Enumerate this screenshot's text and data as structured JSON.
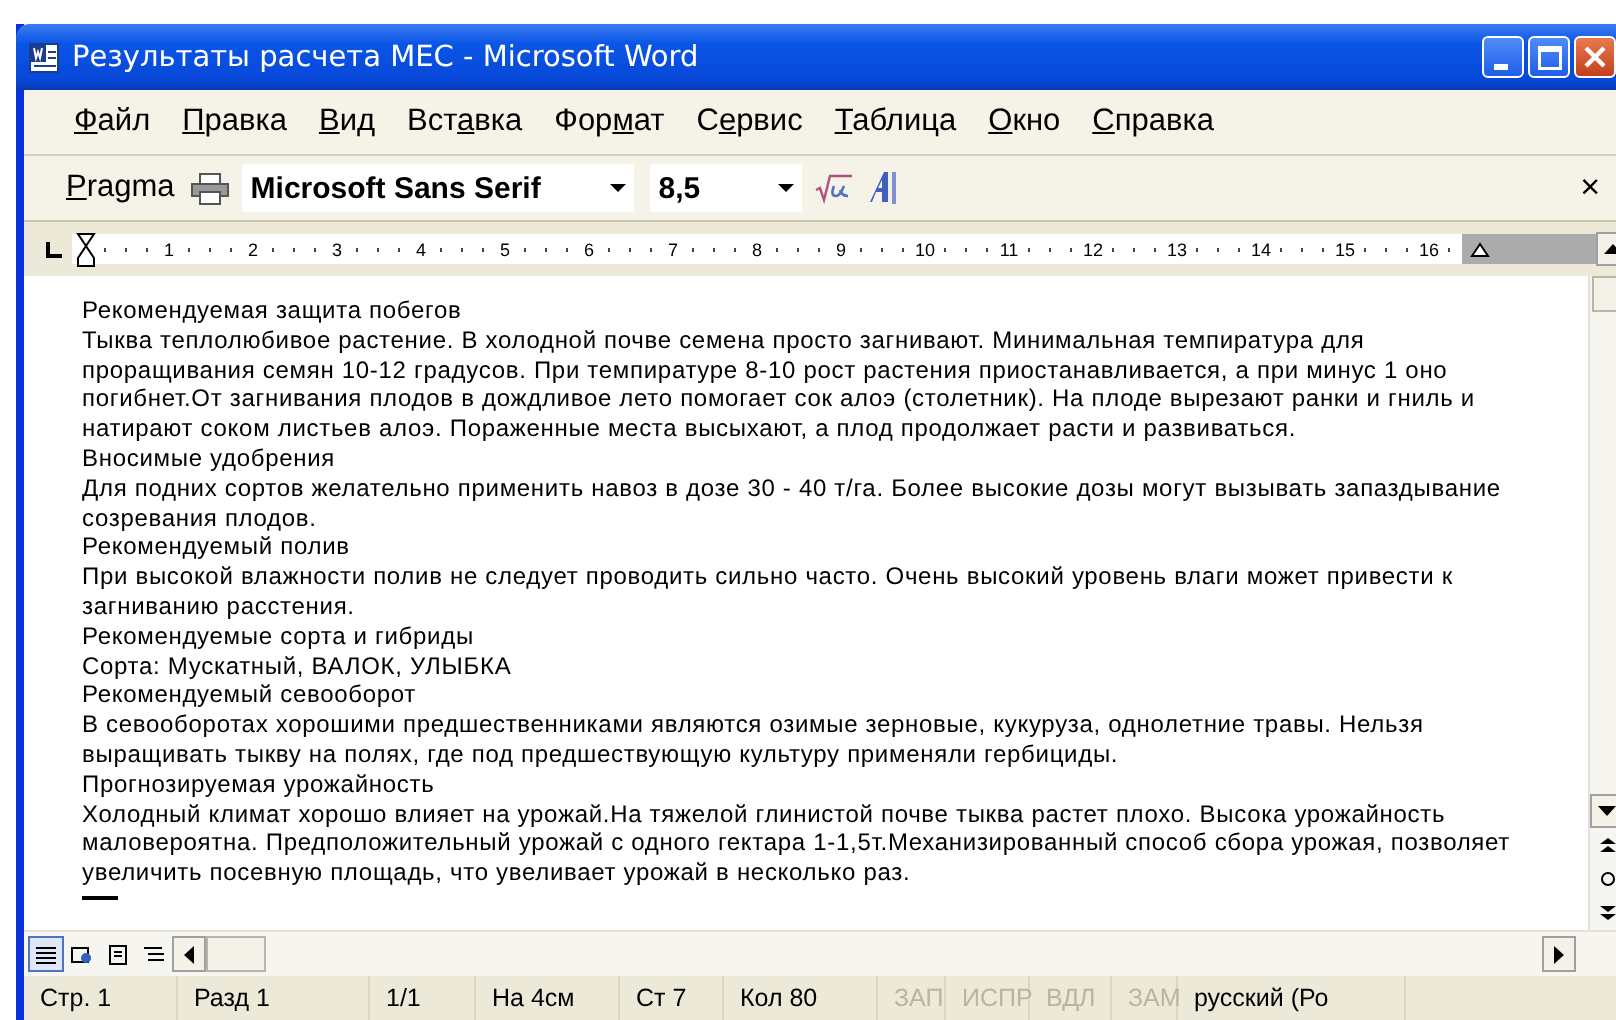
{
  "window": {
    "title": "Результаты расчета МЕС - Microsoft Word"
  },
  "menu": [
    {
      "key": "Ф",
      "after": "айл"
    },
    {
      "key": "П",
      "after": "равка"
    },
    {
      "key": "В",
      "after": "ид"
    },
    {
      "before": "Вст",
      "key": "а",
      "after": "вка"
    },
    {
      "before": "Фор",
      "key": "м",
      "after": "ат"
    },
    {
      "before": "С",
      "key": "е",
      "after": "рвис"
    },
    {
      "key": "Т",
      "after": "аблица"
    },
    {
      "key": "О",
      "after": "кно"
    },
    {
      "key": "С",
      "after": "правка"
    }
  ],
  "toolbar": {
    "style": {
      "key": "P",
      "after": "ragma"
    },
    "font": "Microsoft Sans Serif",
    "size": "8,5",
    "close": "×"
  },
  "ruler": {
    "numbers": [
      "1",
      "2",
      "3",
      "4",
      "5",
      "6",
      "7",
      "8",
      "9",
      "10",
      "11",
      "12",
      "13",
      "14",
      "15",
      "16"
    ]
  },
  "document": {
    "paragraphs": [
      "Рекомендуемая защита побегов",
      "Тыква теплолюбивое растение. В холодной почве семена просто загнивают. Минимальная темпиратура для проращивания семян 10-12 градусов. При темпиратуре 8-10 рост растения приостанавливается, а при минус 1 оно погибнет.От загнивания плодов в дождливое лето помогает сок алоэ (столетник). На плоде вырезают ранки и гниль и натирают соком листьев алоэ. Пораженные места высыхают, а плод продолжает расти и развиваться.",
      "Вносимые удобрения",
      "Для подних сортов желательно применить навоз  в дозе 30 - 40 т/га. Более высокие дозы могут вызывать запаздывание созревания плодов.",
      "Рекомендуемый полив",
      "При высокой влажности полив не следует проводить сильно часто. Очень высокий уровень влаги может привести к загниванию расстения.",
      "Рекомендуемые сорта и гибриды",
      "Сорта: Мускатный, ВАЛОК, УЛЫБКА",
      "Рекомендуемый севооборот",
      "В севооборотах хорошими предшественниками являются озимые зерновые, кукуруза, однолетние травы. Нельзя выращивать тыкву на полях, где под предшествующую культуру применяли гербициды.",
      "Прогнозируемая урожайность",
      "Холодный климат хорошо влияет на урожай.На тяжелой глинистой почве тыква растет плохо. Высока урожайность маловероятна. Предположительный урожай с одного гектара 1-1,5т.Механизированный способ сбора урожая, позволяет увеличить посевную площадь, что увеливает урожай в несколько раз."
    ]
  },
  "view_buttons": [
    {
      "kind": "normal",
      "selected": true
    },
    {
      "kind": "web",
      "selected": false
    },
    {
      "kind": "print",
      "selected": false
    },
    {
      "kind": "outline",
      "selected": false
    }
  ],
  "status_bar": [
    {
      "text": "Стр. 1",
      "disabled": false
    },
    {
      "text": "Разд 1",
      "disabled": false
    },
    {
      "text": "1/1",
      "disabled": false
    },
    {
      "text": "На 4см",
      "disabled": false
    },
    {
      "text": "Ст 7",
      "disabled": false
    },
    {
      "text": "Кол 80",
      "disabled": false
    },
    {
      "text": "ЗАП",
      "disabled": true
    },
    {
      "text": "ИСПР",
      "disabled": true
    },
    {
      "text": "ВДЛ",
      "disabled": true
    },
    {
      "text": "ЗАМ",
      "disabled": true
    },
    {
      "text": "русский (Ро",
      "disabled": false
    }
  ]
}
